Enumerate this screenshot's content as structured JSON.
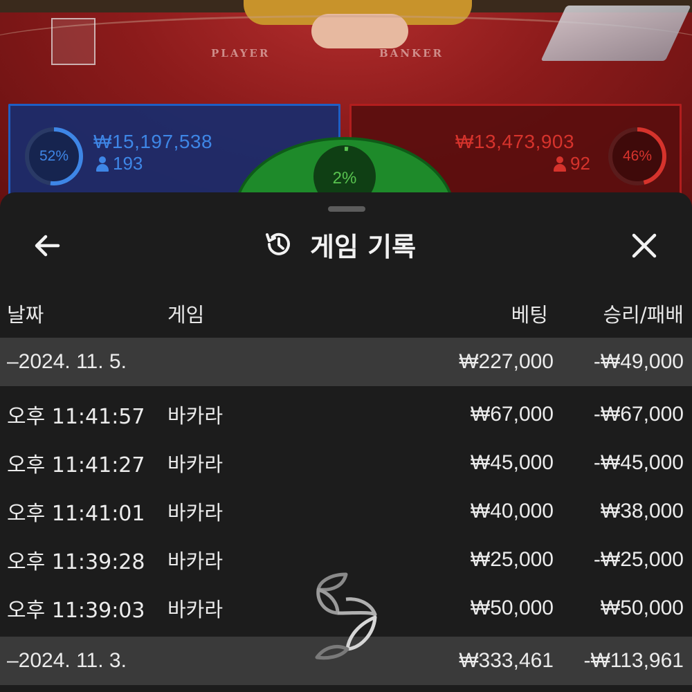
{
  "table": {
    "player_label": "PLAYER",
    "banker_label": "BANKER",
    "player": {
      "percent_label": "52%",
      "percent_value": 0.52,
      "amount": "₩15,197,538",
      "count": "193",
      "color": "#3e86e6"
    },
    "banker": {
      "percent_label": "46%",
      "percent_value": 0.46,
      "amount": "₩13,473,903",
      "count": "92",
      "color": "#d6332c"
    },
    "tie": {
      "percent_label": "2%",
      "percent_value": 0.02,
      "color": "#58c34f"
    }
  },
  "sheet": {
    "title": "게임 기록",
    "icons": {
      "back": "arrow-left-icon",
      "history": "history-icon",
      "close": "close-icon",
      "loading": "loading-spinner-icon"
    },
    "columns": {
      "date": "날짜",
      "game": "게임",
      "bet": "베팅",
      "result": "승리/패배"
    },
    "groups": [
      {
        "date": "–2024. 11. 5.",
        "bet_total": "₩227,000",
        "result_total": "-₩49,000",
        "rows": [
          {
            "time": "오후 11:41:57",
            "game": "바카라",
            "bet": "₩67,000",
            "result": "-₩67,000"
          },
          {
            "time": "오후 11:41:27",
            "game": "바카라",
            "bet": "₩45,000",
            "result": "-₩45,000"
          },
          {
            "time": "오후 11:41:01",
            "game": "바카라",
            "bet": "₩40,000",
            "result": "₩38,000"
          },
          {
            "time": "오후 11:39:28",
            "game": "바카라",
            "bet": "₩25,000",
            "result": "-₩25,000"
          },
          {
            "time": "오후 11:39:03",
            "game": "바카라",
            "bet": "₩50,000",
            "result": "₩50,000"
          }
        ]
      },
      {
        "date": "–2024. 11. 3.",
        "bet_total": "₩333,461",
        "result_total": "-₩113,961",
        "rows": []
      }
    ]
  }
}
